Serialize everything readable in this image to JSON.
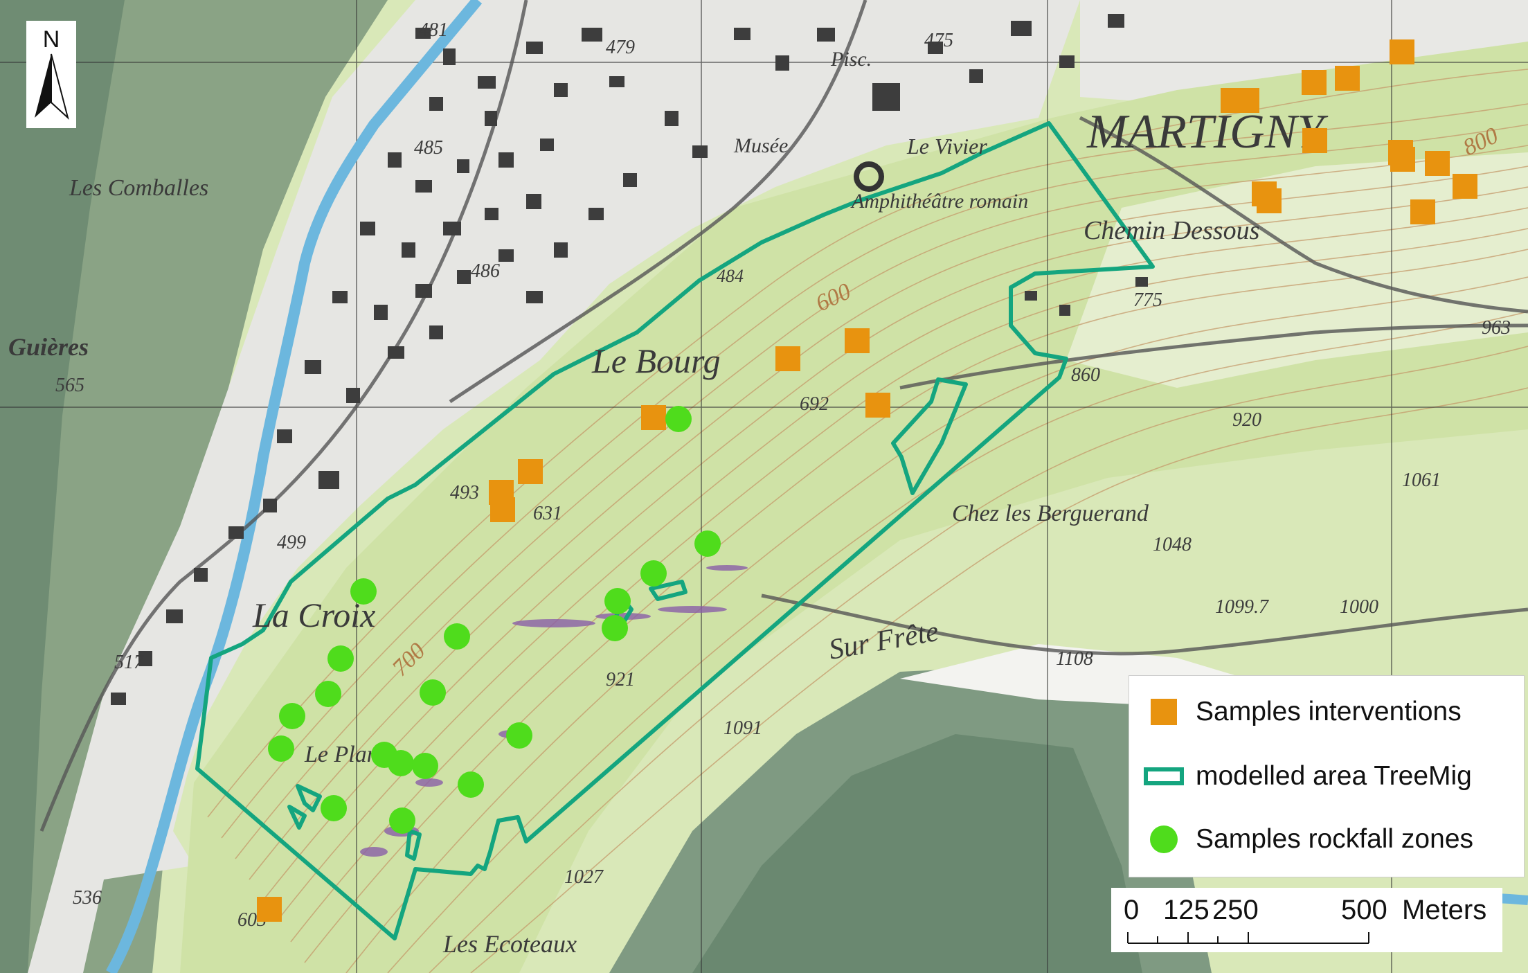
{
  "map": {
    "place_labels": [
      "MARTIGNY",
      "Le Bourg",
      "La Croix",
      "Les Comballes",
      "Guières",
      "Chemin Dessous",
      "Amphithéâtre romain",
      "Le Vivier",
      "Musée",
      "Chez les Berguerand",
      "Sur Frête",
      "Les Ecoteaux",
      "Le Plan",
      "Pisc."
    ],
    "elevation_labels": [
      "481",
      "479",
      "475",
      "485",
      "486",
      "484",
      "775",
      "963",
      "860",
      "920",
      "1061",
      "1048",
      "1099.7",
      "1000",
      "1108",
      "692",
      "631",
      "493",
      "499",
      "517",
      "565",
      "536",
      "921",
      "1091",
      "1027",
      "603"
    ],
    "contour_labels": [
      "600",
      "700",
      "800"
    ],
    "colors": {
      "intervention": "#e8930f",
      "treemig": "#14a57f",
      "rockfall": "#4fdc1c",
      "valley_floor": "#e9e9e6",
      "slope_green": "#cfe2a6",
      "forest_dark": "#6b8a70",
      "river": "#7fc4e6"
    }
  },
  "legend": {
    "items": [
      {
        "label": "Samples interventions",
        "symbol": "orange-square"
      },
      {
        "label": "modelled area TreeMig",
        "symbol": "teal-outline-rectangle"
      },
      {
        "label": "Samples rockfall zones",
        "symbol": "green-circle"
      }
    ]
  },
  "scale_bar": {
    "ticks": [
      "0",
      "125",
      "250",
      "500"
    ],
    "unit": "Meters"
  },
  "north_arrow": {
    "label": "N"
  }
}
